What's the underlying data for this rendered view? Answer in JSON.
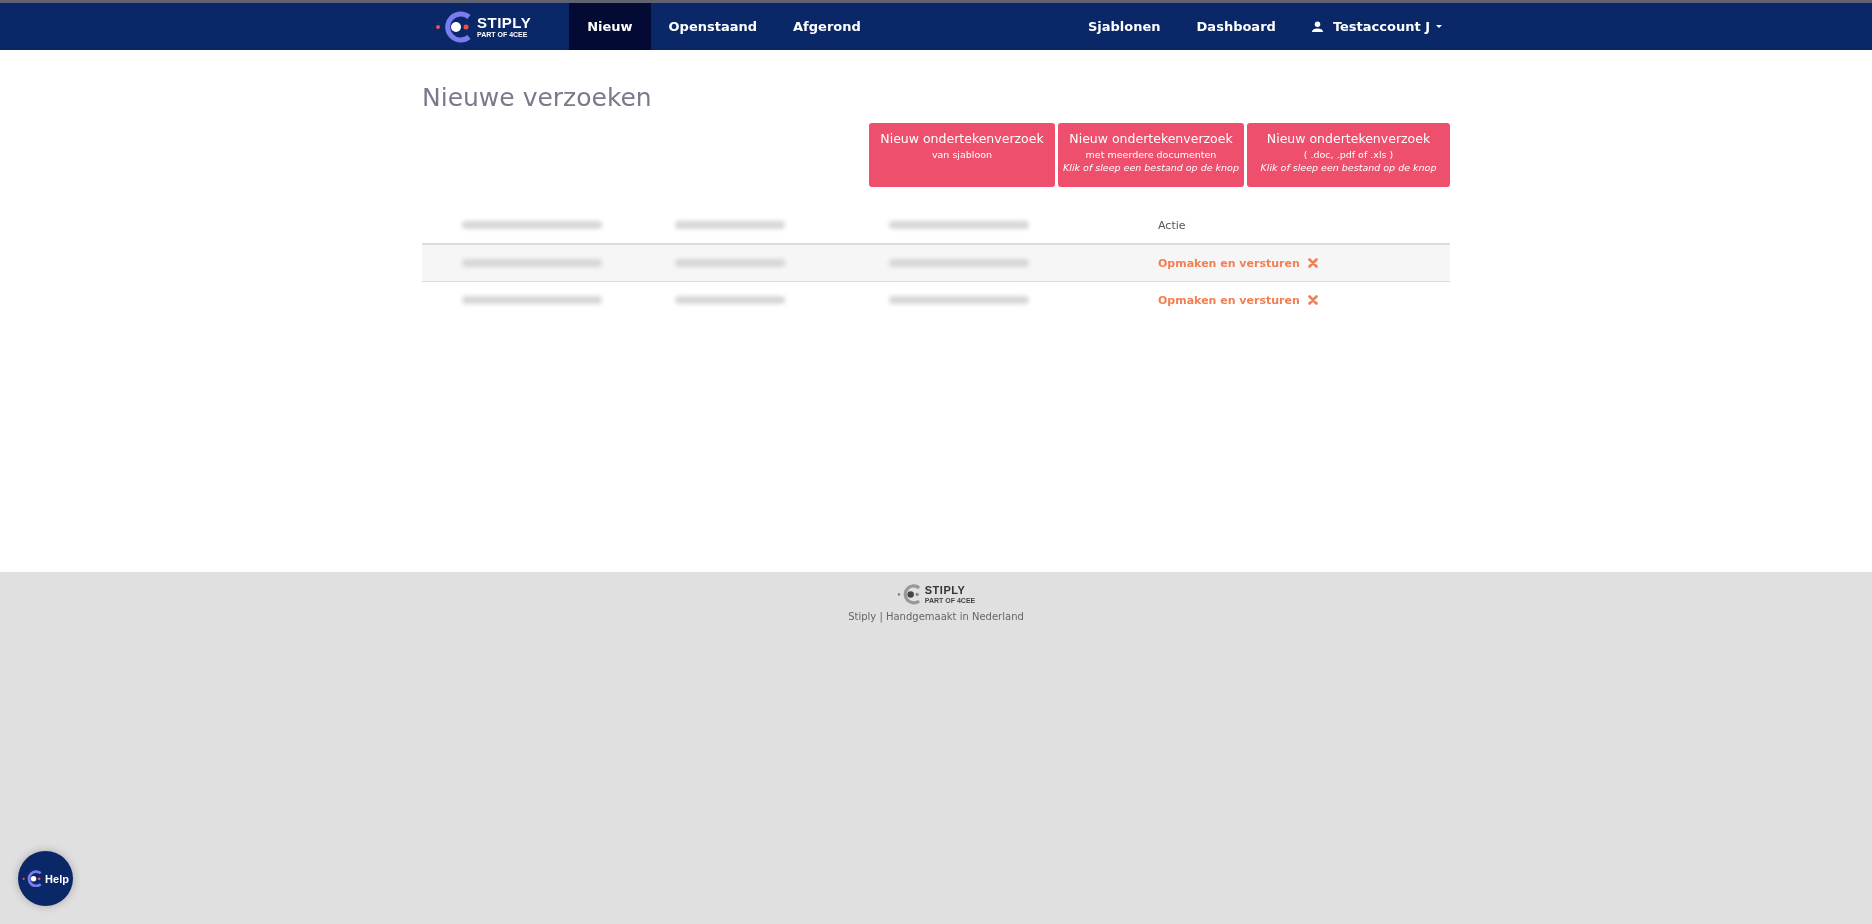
{
  "navbar": {
    "logo": {
      "name": "STIPLY",
      "tagline": "PART OF 4CEE"
    },
    "tabs": [
      {
        "label": "Nieuw",
        "selected": true
      },
      {
        "label": "Openstaand",
        "selected": false
      },
      {
        "label": "Afgerond",
        "selected": false
      }
    ],
    "right_links": [
      {
        "label": "Sjablonen",
        "kind": "link"
      },
      {
        "label": "Dashboard",
        "kind": "link"
      },
      {
        "label": "Testaccount J",
        "kind": "user"
      }
    ]
  },
  "page_title": "Nieuwe verzoeken",
  "new_buttons": [
    {
      "title": "Nieuw ondertekenverzoek",
      "subtitle": "van sjabloon"
    },
    {
      "title": "Nieuw ondertekenverzoek",
      "subtitle": "met meerdere documenten",
      "hint": "Klik of sleep een bestand op de knop"
    },
    {
      "title": "Nieuw ondertekenverzoek",
      "subtitle": "( .doc, .pdf of .xls )",
      "hint": "Klik of sleep een bestand op de knop"
    }
  ],
  "table": {
    "action_column": "Actie",
    "rows": [
      {
        "action": "Opmaken en versturen"
      },
      {
        "action": "Opmaken en versturen"
      }
    ]
  },
  "footer": {
    "logo": {
      "name": "STIPLY",
      "tagline": "PART OF 4CEE"
    },
    "text": "Stiply | Handgemaakt in Nederland"
  },
  "help_button": {
    "label": "Help"
  }
}
